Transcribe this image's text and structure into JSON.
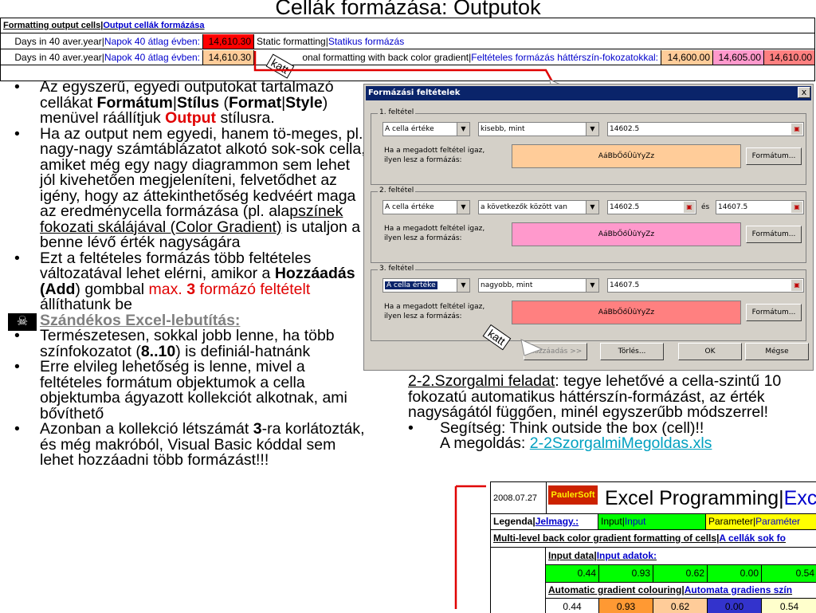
{
  "title": "Cellák formázása: Outputok",
  "top_table": {
    "header_en": "Formatting output cells",
    "header_hu": "Output cellák formázása",
    "row1": {
      "label_en": "Days in 40 aver.year",
      "label_hu": "Napok 40 átlag évben:",
      "value": "14,610.30",
      "desc_en": "Static formatting",
      "desc_hu": "Statikus formázás"
    },
    "row2": {
      "label_en": "Days in 40 aver.year",
      "label_hu": "Napok 40 átlag évben:",
      "value": "14,610.30",
      "desc_en": "onal formatting with back color gradient",
      "desc_hu": "Feltételes formázás háttérszín-fokozatokkal:",
      "g1": "14,600.00",
      "g2": "14,605.00",
      "g3": "14,610.00"
    },
    "sep": "|",
    "colors": {
      "static": "#ff0000",
      "g1": "#ffcc99",
      "g2": "#ff99cc",
      "g3": "#ff8080"
    }
  },
  "annotation_katt": "katt",
  "left_text": {
    "b1": {
      "p1": "Az egyszerű, egyedi outputokat tartalmazó cellákat ",
      "format": "Formátum",
      "sep": "|",
      "style_hu": "Stílus",
      "p2": " (",
      "format_en": "Format",
      "style_en": "Style",
      "p3": ") menüvel ráállítjuk ",
      "output": "Output",
      "p4": " stílusra."
    },
    "b2": {
      "p1": "Ha az output nem egyedi, hanem tö-meges, pl. nagy-nagy számtáblázatot alkotó sok-sok cella, amiket még egy nagy diagrammon sem lehet jól kivehetően megjeleníteni, felvetődhet az igény, hogy az áttekinthetőség kedvéért maga az eredménycella formázása (pl. ala",
      "ul": "pszínek fokozati skálájával (Color Gradient)",
      "p2": " is utaljon a benne lévő érték nagyságára"
    },
    "b3": {
      "p1": "Ezt a feltételes formázás több feltételes változatával lehet elérni, amikor a ",
      "add": "Hozzáadás (Add",
      "p2": ") gombbal ",
      "max": "max. ",
      "three": "3",
      "p3": " formázó feltételt",
      "p4": " állíthatunk be"
    },
    "hack_title": "Szándékos Excel-lebutítás:",
    "b4": {
      "p1": "Természetesen, sokkal jobb lenne, ha több színfokozatot (",
      "range": "8..10",
      "p2": ") is definiál-hatnánk"
    },
    "b5": "Erre elvileg lehetőség is lenne, mivel a feltételes formátum objektumok a cella objektumba ágyazott kollekciót alkotnak, ami bővíthető",
    "b6": {
      "p1": "Azonban a kollekció létszámát ",
      "three": "3",
      "p2": "-ra korlátozták, és még makróból, Visual Basic kóddal sem lehet hozzáadni több formázást!!!"
    }
  },
  "dialog": {
    "title": "Formázási feltételek",
    "close": "x",
    "cond1": {
      "label": "1. feltétel",
      "type": "A cella értéke",
      "op": "kisebb, mint",
      "v1": "14602.5",
      "hint": "Ha a megadott feltétel igaz,\nilyen lesz a formázás:",
      "preview": "AáBbŐőÛûYyZz",
      "color": "#ffcc99",
      "btn": "Formátum..."
    },
    "cond2": {
      "label": "2. feltétel",
      "type": "A cella értéke",
      "op": "a következők között van",
      "v1": "14602.5",
      "and": "és",
      "v2": "14607.5",
      "hint": "Ha a megadott feltétel igaz,\nilyen lesz a formázás:",
      "preview": "AáBbŐőÛûYyZz",
      "color": "#ff99cc",
      "btn": "Formátum..."
    },
    "cond3": {
      "label": "3. feltétel",
      "type": "A cella értéke",
      "op": "nagyobb, mint",
      "v1": "14607.5",
      "hint": "Ha a megadott feltétel igaz,\nilyen lesz a formázás:",
      "preview": "AáBbŐőÛûYyZz",
      "color": "#ff8080",
      "btn": "Formátum..."
    },
    "buttons": {
      "add": "Hozzáadás >>",
      "delete": "Törlés...",
      "ok": "OK",
      "cancel": "Mégse"
    }
  },
  "right_text": {
    "task_label": "2-2.Szorgalmi feladat",
    "task_text": ": tegye lehetővé a cella-szintű 10 fokozatú automatikus háttérszín-formázást, az érték nagyságától függően, minél egyszerűbb módszerrel!",
    "hint": "Segítség: Think outside the box (cell)!!",
    "solution_label": "A megoldás: ",
    "solution_link": "2-2SzorgalmiMegoldas.xls"
  },
  "sheet2": {
    "date": "2008.07.27",
    "logo": "PaulerSoft",
    "heading_en": "Excel Programming",
    "heading_hu": "Excel p",
    "legend": "Legenda",
    "legend_hu": "Jelmagy.:",
    "input": "Input",
    "input_hu": "Input",
    "parameter": "Parameter",
    "parameter_hu": "Paraméter",
    "multi": "Multi-level back color gradient formatting of cells",
    "multi_hu": "A cellák sok fo",
    "input_data": "Input data",
    "input_data_hu": "Input adatok:",
    "inputs": [
      "0.44",
      "0.93",
      "0.62",
      "0.00",
      "0.54"
    ],
    "auto": "Automatic gradient colouring",
    "auto_hu": "Automata gradiens szín",
    "outputs": [
      "0.44",
      "0.93",
      "0.62",
      "0.00",
      "0.54"
    ],
    "output_colors": [
      "#ffffff",
      "#ff9933",
      "#ffcc99",
      "#3333cc",
      "#ffffcc"
    ]
  }
}
